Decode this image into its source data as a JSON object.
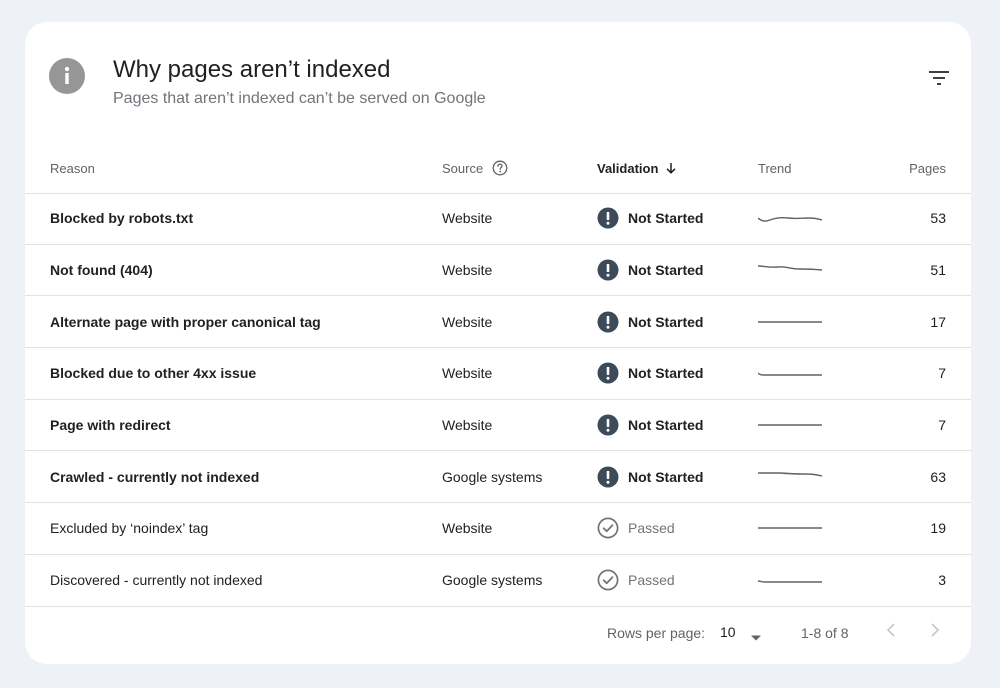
{
  "header": {
    "title": "Why pages aren’t indexed",
    "subtitle": "Pages that aren’t indexed can’t be served on Google",
    "icon": "info-icon",
    "filter_icon": "filter-icon"
  },
  "table": {
    "columns": {
      "reason": "Reason",
      "source": "Source",
      "validation": "Validation",
      "trend": "Trend",
      "pages": "Pages"
    },
    "rows": [
      {
        "reason": "Blocked by robots.txt",
        "source": "Website",
        "validation": "Not Started",
        "pages": "53",
        "bold": true,
        "status": "not-started"
      },
      {
        "reason": "Not found (404)",
        "source": "Website",
        "validation": "Not Started",
        "pages": "51",
        "bold": true,
        "status": "not-started"
      },
      {
        "reason": "Alternate page with proper canonical tag",
        "source": "Website",
        "validation": "Not Started",
        "pages": "17",
        "bold": true,
        "status": "not-started"
      },
      {
        "reason": "Blocked due to other 4xx issue",
        "source": "Website",
        "validation": "Not Started",
        "pages": "7",
        "bold": true,
        "status": "not-started"
      },
      {
        "reason": "Page with redirect",
        "source": "Website",
        "validation": "Not Started",
        "pages": "7",
        "bold": true,
        "status": "not-started"
      },
      {
        "reason": "Crawled - currently not indexed",
        "source": "Google systems",
        "validation": "Not Started",
        "pages": "63",
        "bold": true,
        "status": "not-started"
      },
      {
        "reason": "Excluded by ‘noindex’ tag",
        "source": "Website",
        "validation": "Passed",
        "pages": "19",
        "bold": false,
        "status": "passed"
      },
      {
        "reason": "Discovered - currently not indexed",
        "source": "Google systems",
        "validation": "Passed",
        "pages": "3",
        "bold": false,
        "status": "passed"
      }
    ]
  },
  "footer": {
    "rows_per_page_label": "Rows per page:",
    "rows_per_page_value": "10",
    "range": "1-8 of 8"
  },
  "colors": {
    "background": "#eef1f6",
    "card": "#ffffff",
    "status_not_started": "#3c4a5a",
    "status_passed": "#70757a",
    "sparkline": "#5f6368"
  }
}
